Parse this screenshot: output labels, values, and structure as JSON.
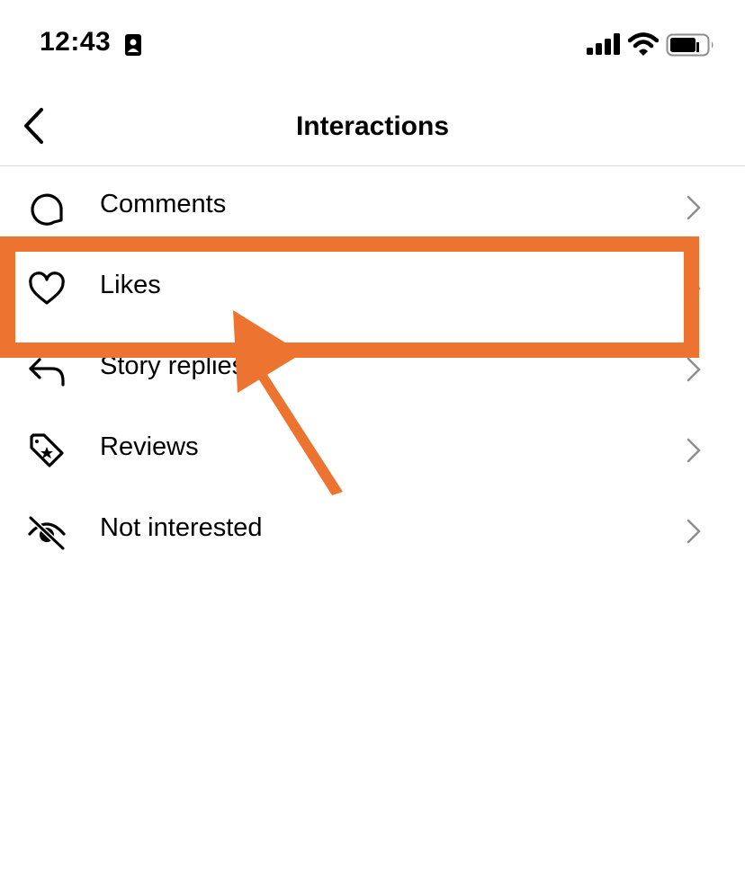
{
  "status_bar": {
    "time": "12:43",
    "icons": [
      "focus-mode-icon",
      "cellular-signal-icon",
      "wifi-icon",
      "battery-icon"
    ]
  },
  "nav": {
    "title": "Interactions",
    "back_icon": "chevron-left-icon"
  },
  "menu": {
    "items": [
      {
        "label": "Comments",
        "icon": "comment-icon"
      },
      {
        "label": "Likes",
        "icon": "heart-icon"
      },
      {
        "label": "Story replies",
        "icon": "reply-icon"
      },
      {
        "label": "Reviews",
        "icon": "tag-star-icon"
      },
      {
        "label": "Not interested",
        "icon": "eye-slash-icon"
      }
    ],
    "chevron_icon": "chevron-right-icon"
  },
  "annotation": {
    "highlighted_item": "Likes",
    "color": "#ED7430",
    "shapes": [
      "highlight-rectangle",
      "pointer-arrow"
    ]
  }
}
